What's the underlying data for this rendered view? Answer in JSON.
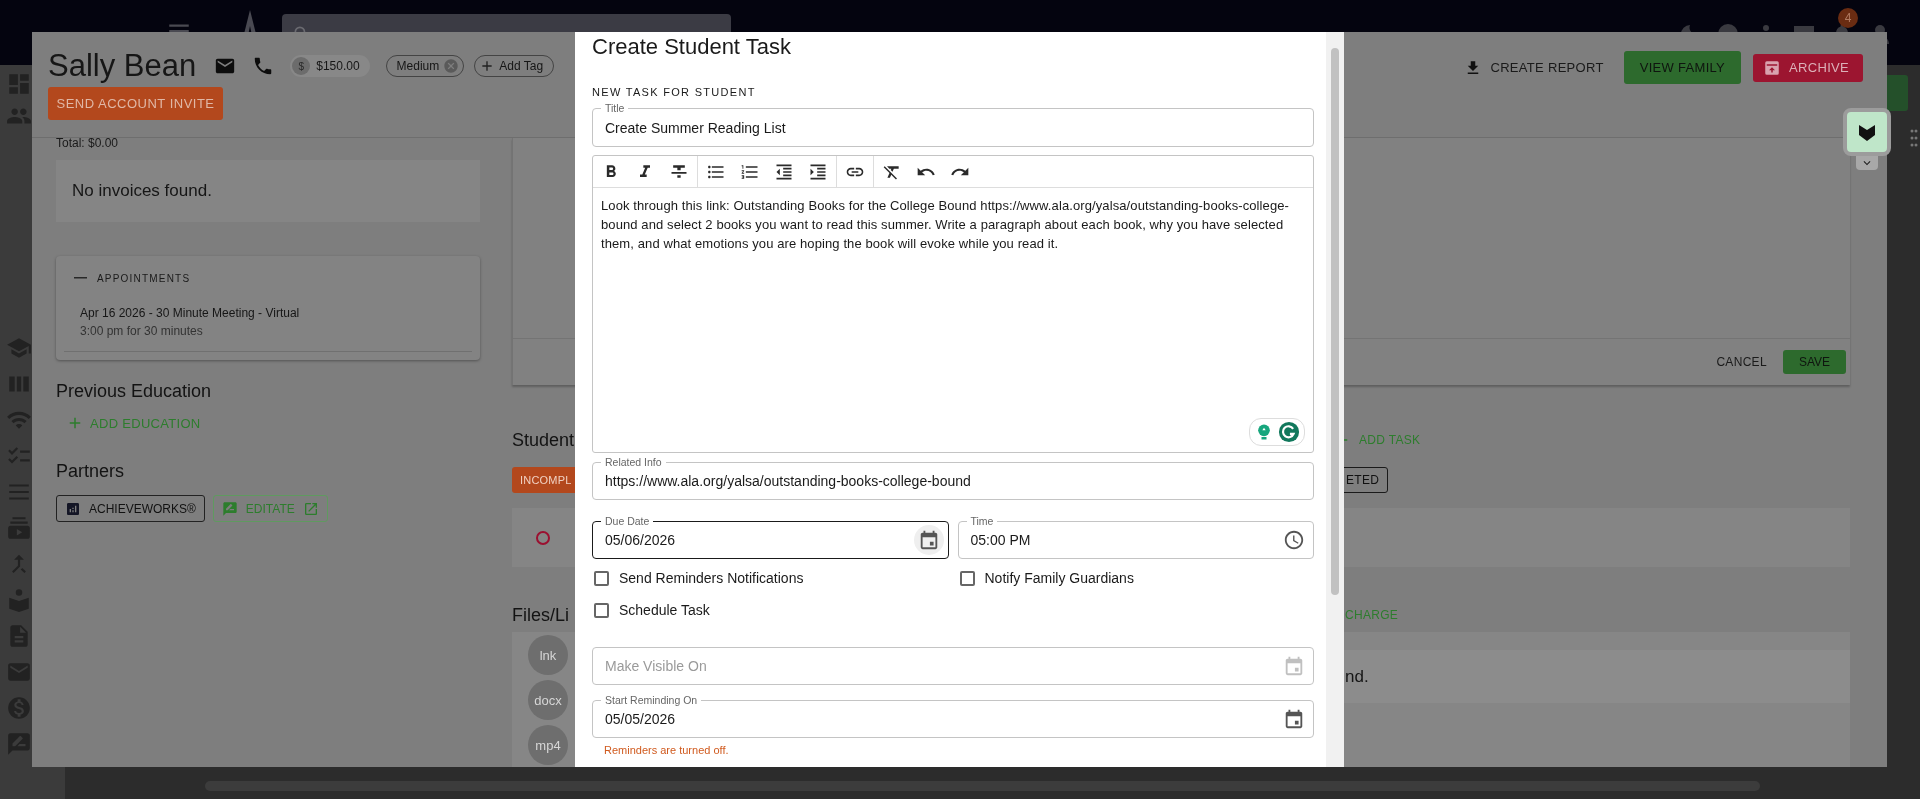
{
  "topbar": {
    "notification_count": "4"
  },
  "profile": {
    "name": "Sally Bean",
    "currency_symbol": "$",
    "balance": "$150.00",
    "tags": [
      {
        "label": "Medium",
        "removable": true
      }
    ],
    "add_tag": "Add Tag",
    "invite_button": "SEND ACCOUNT INVITE",
    "actions": [
      {
        "label": "CREATE REPORT",
        "kind": "text"
      },
      {
        "label": "VIEW FAMILY",
        "kind": "green"
      },
      {
        "label": "ARCHIVE",
        "kind": "red"
      }
    ]
  },
  "invoices": {
    "total": "Total: $0.00",
    "empty": "No invoices found."
  },
  "appointments": {
    "heading": "APPOINTMENTS",
    "items": [
      {
        "title": "Apr 16 2026 - 30 Minute Meeting - Virtual",
        "detail": "3:00 pm for 30 minutes"
      }
    ]
  },
  "previous_education": {
    "heading": "Previous Education",
    "add": "ADD EDUCATION"
  },
  "partners": {
    "heading": "Partners",
    "items": [
      {
        "label": "ACHIEVEWORKS®",
        "kind": "outlined"
      },
      {
        "label": "EDITATE",
        "kind": "link"
      }
    ]
  },
  "note_editor": {
    "cancel": "CANCEL",
    "save": "SAVE"
  },
  "tasks": {
    "heading": "Student",
    "add": "ADD TASK",
    "filters": [
      {
        "label": "INCOMPL",
        "selected": true
      },
      {
        "label": "ETED",
        "selected": false
      }
    ],
    "rows": [
      {
        "completed": false
      }
    ]
  },
  "files": {
    "heading": "Files/Li",
    "charge": "CHARGE",
    "empty": "nd.",
    "items": [
      "lnk",
      "docx",
      "mp4"
    ]
  },
  "dialog": {
    "title": "Create Student Task",
    "section": "NEW TASK FOR STUDENT",
    "title_field": {
      "label": "Title",
      "value": "Create Summer Reading List"
    },
    "body": "Look through this link: Outstanding Books for the College Bound https://www.ala.org/yalsa/outstanding-books-college-bound and select 2 books you want to read this summer. Write a paragraph about each book, why you have selected them, and what emotions you are hoping the book will evoke while you read it.",
    "form": [
      {
        "kind": "fields",
        "fields": [
          {
            "kind": "text",
            "label": "Related Info",
            "value": "https://www.ala.org/yalsa/outstanding-books-college-bound",
            "focused": false
          }
        ]
      },
      {
        "kind": "fields",
        "fields": [
          {
            "kind": "date",
            "label": "Due Date",
            "value": "05/06/2026",
            "focused": true
          },
          {
            "kind": "time",
            "label": "Time",
            "value": "05:00 PM",
            "focused": false
          }
        ]
      },
      {
        "kind": "checkboxes",
        "items": [
          {
            "label": "Send Reminders Notifications",
            "checked": false
          },
          {
            "label": "Notify Family Guardians",
            "checked": false
          }
        ]
      },
      {
        "kind": "checkboxes",
        "items": [
          {
            "label": "Schedule Task",
            "checked": false
          }
        ]
      },
      {
        "kind": "fields",
        "fields": [
          {
            "kind": "date",
            "placeholder": "Make Visible On",
            "focused": false
          }
        ]
      },
      {
        "kind": "fields",
        "fields": [
          {
            "kind": "date",
            "label": "Start Reminding On",
            "value": "05/05/2026",
            "focused": false,
            "error": "Reminders are turned off."
          }
        ]
      }
    ]
  }
}
